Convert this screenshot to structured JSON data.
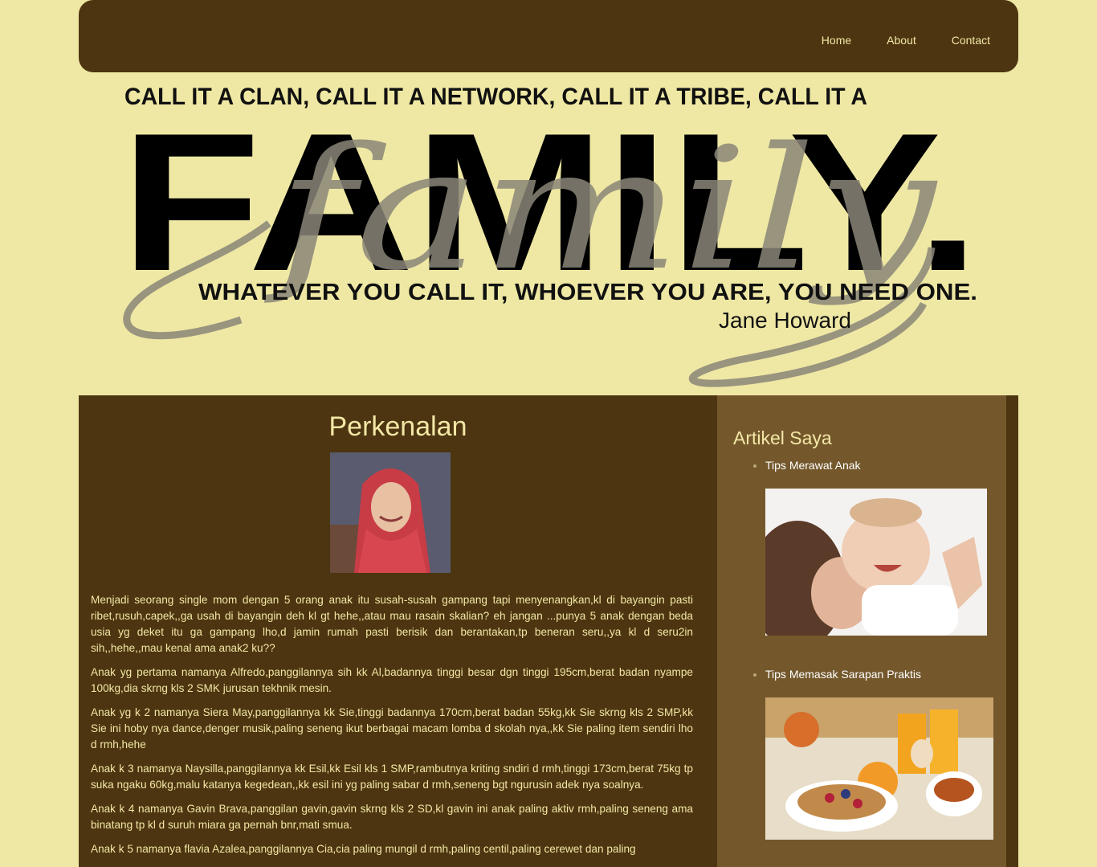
{
  "nav": {
    "links": [
      "Home",
      "About",
      "Contact"
    ]
  },
  "banner": {
    "line1": "CALL IT A CLAN, CALL IT A NETWORK, CALL IT A TRIBE, CALL IT A",
    "big_word": "FAMILY.",
    "script_word": "family",
    "line2": "WHATEVER YOU CALL IT, WHOEVER YOU ARE, YOU NEED ONE.",
    "author": "Jane Howard"
  },
  "main": {
    "title": "Perkenalan",
    "paragraphs": [
      "Menjadi seorang single mom dengan 5 orang anak itu susah-susah gampang tapi menyenangkan,kl di bayangin pasti ribet,rusuh,capek,,ga usah di bayangin deh kl gt hehe,,atau mau rasain skalian? eh jangan ...punya 5 anak dengan beda usia yg deket itu ga gampang lho,d jamin rumah pasti berisik dan berantakan,tp beneran seru,,ya kl d seru2in sih,,hehe,,mau kenal ama anak2 ku??",
      "Anak yg pertama namanya Alfredo,panggilannya sih kk Al,badannya tinggi besar dgn tinggi 195cm,berat badan nyampe 100kg,dia skrng kls 2 SMK jurusan tekhnik mesin.",
      "Anak yg k 2 namanya Siera May,panggilannya kk Sie,tinggi badannya 170cm,berat badan 55kg,kk Sie skrng kls 2 SMP,kk Sie ini hoby nya dance,denger musik,paling seneng ikut berbagai macam lomba d skolah nya,,kk Sie paling item sendiri lho d rmh,hehe",
      "Anak k 3 namanya Naysilla,panggilannya kk Esil,kk Esil kls 1 SMP,rambutnya kriting sndiri d rmh,tinggi 173cm,berat 75kg tp suka ngaku 60kg,malu katanya kegedean,,kk esil ini yg paling sabar d rmh,seneng bgt ngurusin adek nya soalnya.",
      "Anak k 4 namanya Gavin Brava,panggilan gavin,gavin skrng kls 2 SD,kl gavin ini anak paling aktiv rmh,paling seneng ama binatang tp kl d suruh miara ga pernah bnr,mati smua.",
      "Anak k 5 namanya flavia Azalea,panggilannya Cia,cia paling mungil d rmh,paling centil,paling cerewet dan paling"
    ]
  },
  "sidebar": {
    "title": "Artikel Saya",
    "articles": [
      {
        "label": "Tips Merawat Anak"
      },
      {
        "label": "Tips Memasak Sarapan Praktis"
      }
    ]
  }
}
